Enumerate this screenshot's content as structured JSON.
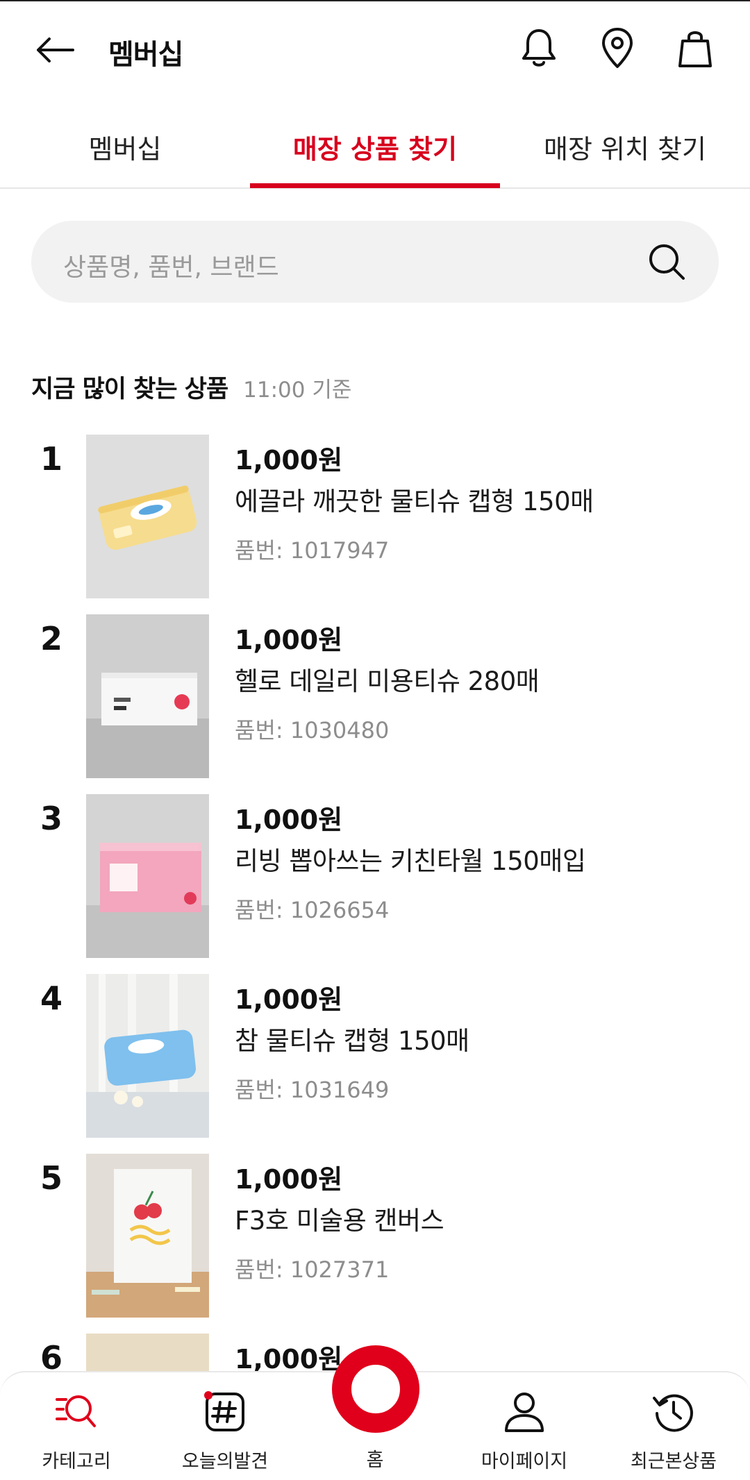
{
  "header": {
    "title": "멤버십"
  },
  "tabs": [
    {
      "label": "멤버십"
    },
    {
      "label": "매장 상품 찾기"
    },
    {
      "label": "매장 위치 찾기"
    }
  ],
  "search": {
    "placeholder": "상품명, 품번, 브랜드"
  },
  "section": {
    "title": "지금 많이 찾는 상품",
    "subtitle": "11:00 기준"
  },
  "products": [
    {
      "rank": "1",
      "price": "1,000원",
      "name": "에끌라 깨끗한 물티슈 캡형 150매",
      "code": "품번: 1017947"
    },
    {
      "rank": "2",
      "price": "1,000원",
      "name": "헬로 데일리 미용티슈 280매",
      "code": "품번: 1030480"
    },
    {
      "rank": "3",
      "price": "1,000원",
      "name": "리빙 뽑아쓰는 키친타월 150매입",
      "code": "품번: 1026654"
    },
    {
      "rank": "4",
      "price": "1,000원",
      "name": "참 물티슈 캡형 150매",
      "code": "품번: 1031649"
    },
    {
      "rank": "5",
      "price": "1,000원",
      "name": "F3호 미술용 캔버스",
      "code": "품번: 1027371"
    },
    {
      "rank": "6",
      "price": "1,000원"
    }
  ],
  "nav": {
    "category": "카테고리",
    "discover": "오늘의발견",
    "home": "홈",
    "mypage": "마이페이지",
    "recent": "최근본상품"
  },
  "colors": {
    "accent": "#d7001d",
    "home_ring": "#e0001b"
  }
}
